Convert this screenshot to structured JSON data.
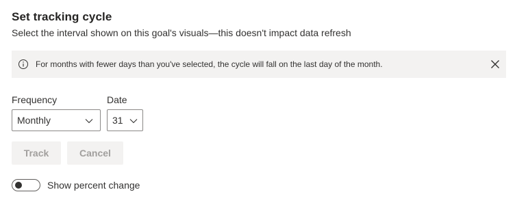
{
  "dialog": {
    "title": "Set tracking cycle",
    "subtitle": "Select the interval shown on this goal's visuals—this doesn't impact data refresh"
  },
  "banner": {
    "icon": "info-icon",
    "message": "For months with fewer days than you've selected, the cycle will fall on the last day of the month.",
    "close_icon": "close-icon"
  },
  "frequency": {
    "label": "Frequency",
    "selected": "Monthly"
  },
  "date": {
    "label": "Date",
    "selected": "31"
  },
  "actions": {
    "track_label": "Track",
    "cancel_label": "Cancel"
  },
  "percent_toggle": {
    "label": "Show percent change",
    "on": false
  },
  "colors": {
    "banner_bg": "#f3f2f1",
    "disabled_button_bg": "#f3f2f1",
    "disabled_text": "#a19f9d"
  }
}
